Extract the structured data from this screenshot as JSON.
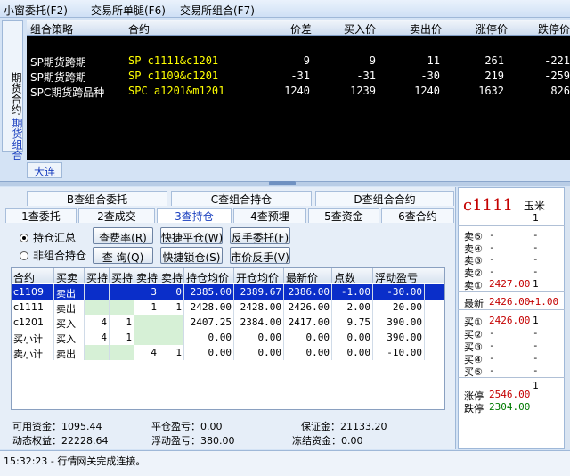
{
  "menu": {
    "items": [
      "小窗委托(F2)",
      "交易所单腿(F6)",
      "交易所组合(F7)"
    ]
  },
  "side_tabs": {
    "tab1": "期货合约",
    "tab2": "期货组合"
  },
  "quote_grid": {
    "columns": [
      "组合策略",
      "合约",
      "价差",
      "买入价",
      "卖出价",
      "涨停价",
      "跌停价"
    ],
    "rows": [
      {
        "strategy": "SP期货跨期",
        "contract": "SP c1111&c1201",
        "spread": "9",
        "bid": "9",
        "ask": "11",
        "limit_up": "261",
        "limit_down": "-221"
      },
      {
        "strategy": "SP期货跨期",
        "contract": "SP c1109&c1201",
        "spread": "-31",
        "bid": "-31",
        "ask": "-30",
        "limit_up": "219",
        "limit_down": "-259"
      },
      {
        "strategy": "SPC期货跨品种",
        "contract": "SPC a1201&m1201",
        "spread": "1240",
        "bid": "1239",
        "ask": "1240",
        "limit_up": "1632",
        "limit_down": "826"
      }
    ]
  },
  "exchange_tab": "大连",
  "order_tabs_row1": [
    "B查组合委托",
    "C查组合持仓",
    "D查组合合约"
  ],
  "order_tabs_row2": [
    "1查委托",
    "2查成交",
    "3查持仓",
    "4查预埋",
    "5查资金",
    "6查合约"
  ],
  "active_tab": "3查持仓",
  "radios": {
    "summary": "持仓汇总",
    "non_combo": "非组合持仓"
  },
  "buttons": {
    "fee_rate": "查费率(R)",
    "query": "查 询(Q)",
    "quick_close": "快捷平仓(W)",
    "quick_lock": "快捷锁仓(S)",
    "reverse_order": "反手委托(F)",
    "market_reverse": "市价反手(V)"
  },
  "positions": {
    "columns": [
      "合约",
      "买卖",
      "买持",
      "买持",
      "卖持",
      "卖持",
      "持仓均价",
      "开仓均价",
      "最新价",
      "点数",
      "浮动盈亏"
    ],
    "rows": [
      {
        "contract": "c1109",
        "side": "卖出",
        "b1": "",
        "b2": "",
        "s1": "3",
        "s2": "0",
        "hold_avg": "2385.00",
        "open_avg": "2389.67",
        "last": "2386.00",
        "points": "-1.00",
        "pnl": "-30.00"
      },
      {
        "contract": "c1111",
        "side": "卖出",
        "b1": "",
        "b2": "",
        "s1": "1",
        "s2": "1",
        "hold_avg": "2428.00",
        "open_avg": "2428.00",
        "last": "2426.00",
        "points": "2.00",
        "pnl": "20.00"
      },
      {
        "contract": "c1201",
        "side": "买入",
        "b1": "4",
        "b2": "1",
        "s1": "",
        "s2": "",
        "hold_avg": "2407.25",
        "open_avg": "2384.00",
        "last": "2417.00",
        "points": "9.75",
        "pnl": "390.00"
      },
      {
        "contract": "买小计",
        "side": "买入",
        "b1": "4",
        "b2": "1",
        "s1": "",
        "s2": "",
        "hold_avg": "0.00",
        "open_avg": "0.00",
        "last": "0.00",
        "points": "0.00",
        "pnl": "390.00"
      },
      {
        "contract": "卖小计",
        "side": "卖出",
        "b1": "",
        "b2": "",
        "s1": "4",
        "s2": "1",
        "hold_avg": "0.00",
        "open_avg": "0.00",
        "last": "0.00",
        "points": "0.00",
        "pnl": "-10.00"
      }
    ]
  },
  "summary": {
    "available": "可用资金：1095.44",
    "dynamic": "动态权益：22228.64",
    "close_pnl": "平仓盈亏：0.00",
    "float_pnl": "浮动盈亏：380.00",
    "margin": "保证金：21133.20",
    "frozen": "冻结资金：0.00"
  },
  "status": "15:32:23 - 行情网关完成连接。",
  "market": {
    "contract": "c1111",
    "name": "玉米",
    "count": "1",
    "asks": [
      {
        "label": "卖⑤",
        "price": "-",
        "vol": "-"
      },
      {
        "label": "卖④",
        "price": "-",
        "vol": "-"
      },
      {
        "label": "卖③",
        "price": "-",
        "vol": "-"
      },
      {
        "label": "卖②",
        "price": "-",
        "vol": "-"
      },
      {
        "label": "卖①",
        "price": "2427.00",
        "vol": "1"
      }
    ],
    "last_label": "最新",
    "last_price": "2426.00",
    "last_change": "+1.00",
    "bids": [
      {
        "label": "买①",
        "price": "2426.00",
        "vol": "1"
      },
      {
        "label": "买②",
        "price": "-",
        "vol": "-"
      },
      {
        "label": "买③",
        "price": "-",
        "vol": "-"
      },
      {
        "label": "买④",
        "price": "-",
        "vol": "-"
      },
      {
        "label": "买⑤",
        "price": "-",
        "vol": "-"
      }
    ],
    "extra_vol": "1",
    "limit_up_label": "涨停",
    "limit_up": "2546.00",
    "limit_down_label": "跌停",
    "limit_down": "2304.00"
  },
  "colors": {
    "red": "#c40000",
    "green": "#007a00",
    "yellow": "#ffff00",
    "selection": "#0a2ec9"
  }
}
